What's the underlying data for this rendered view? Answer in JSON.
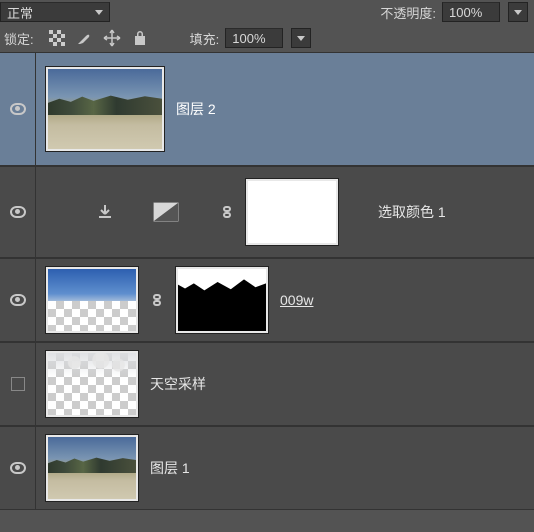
{
  "top": {
    "blend_mode": "正常",
    "opacity_label": "不透明度:",
    "opacity_value": "100%"
  },
  "lock": {
    "label": "锁定:",
    "fill_label": "填充:",
    "fill_value": "100%"
  },
  "layers": [
    {
      "name": "图层 2"
    },
    {
      "name": "选取颜色 1"
    },
    {
      "name": "009w"
    },
    {
      "name": "天空采样"
    },
    {
      "name": "图层 1"
    }
  ]
}
